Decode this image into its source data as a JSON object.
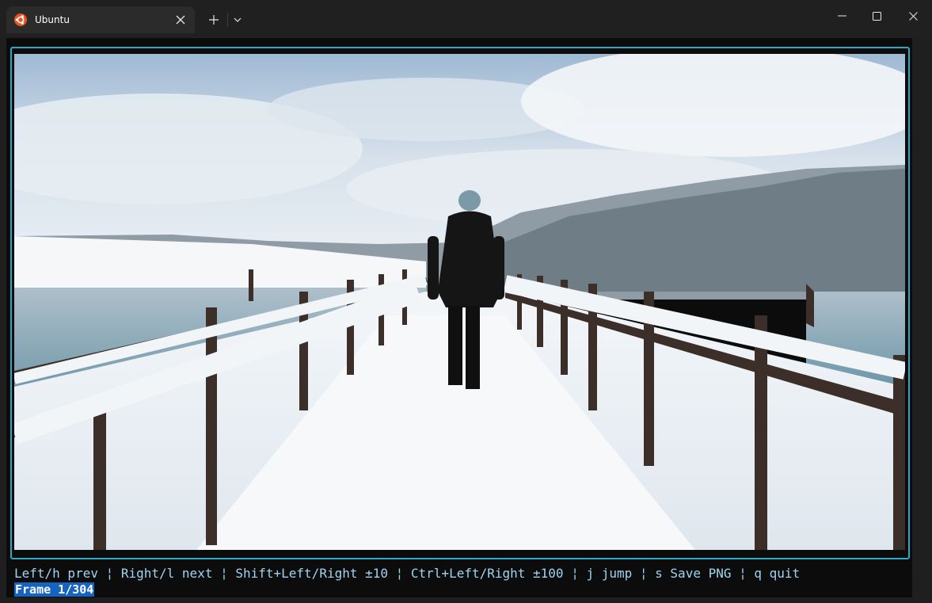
{
  "window": {
    "tab_title": "Ubuntu",
    "icons": {
      "tab": "ubuntu-logo-icon",
      "close_tab": "close-icon",
      "new_tab": "plus-icon",
      "dropdown": "chevron-down-icon",
      "minimize": "minimize-icon",
      "maximize": "maximize-icon",
      "close_window": "close-icon"
    }
  },
  "viewer": {
    "hint": "Left/h prev ¦ Right/l next ¦ Shift+Left/Right ±10 ¦ Ctrl+Left/Right ±100 ¦ j jump ¦ s Save PNG ¦ q quit",
    "status": "Frame 1/304"
  },
  "colors": {
    "accent_border": "#2aa7c9",
    "hint_text": "#9fd4f0",
    "status_bg": "#1565c0",
    "ubuntu_orange": "#e95420"
  }
}
